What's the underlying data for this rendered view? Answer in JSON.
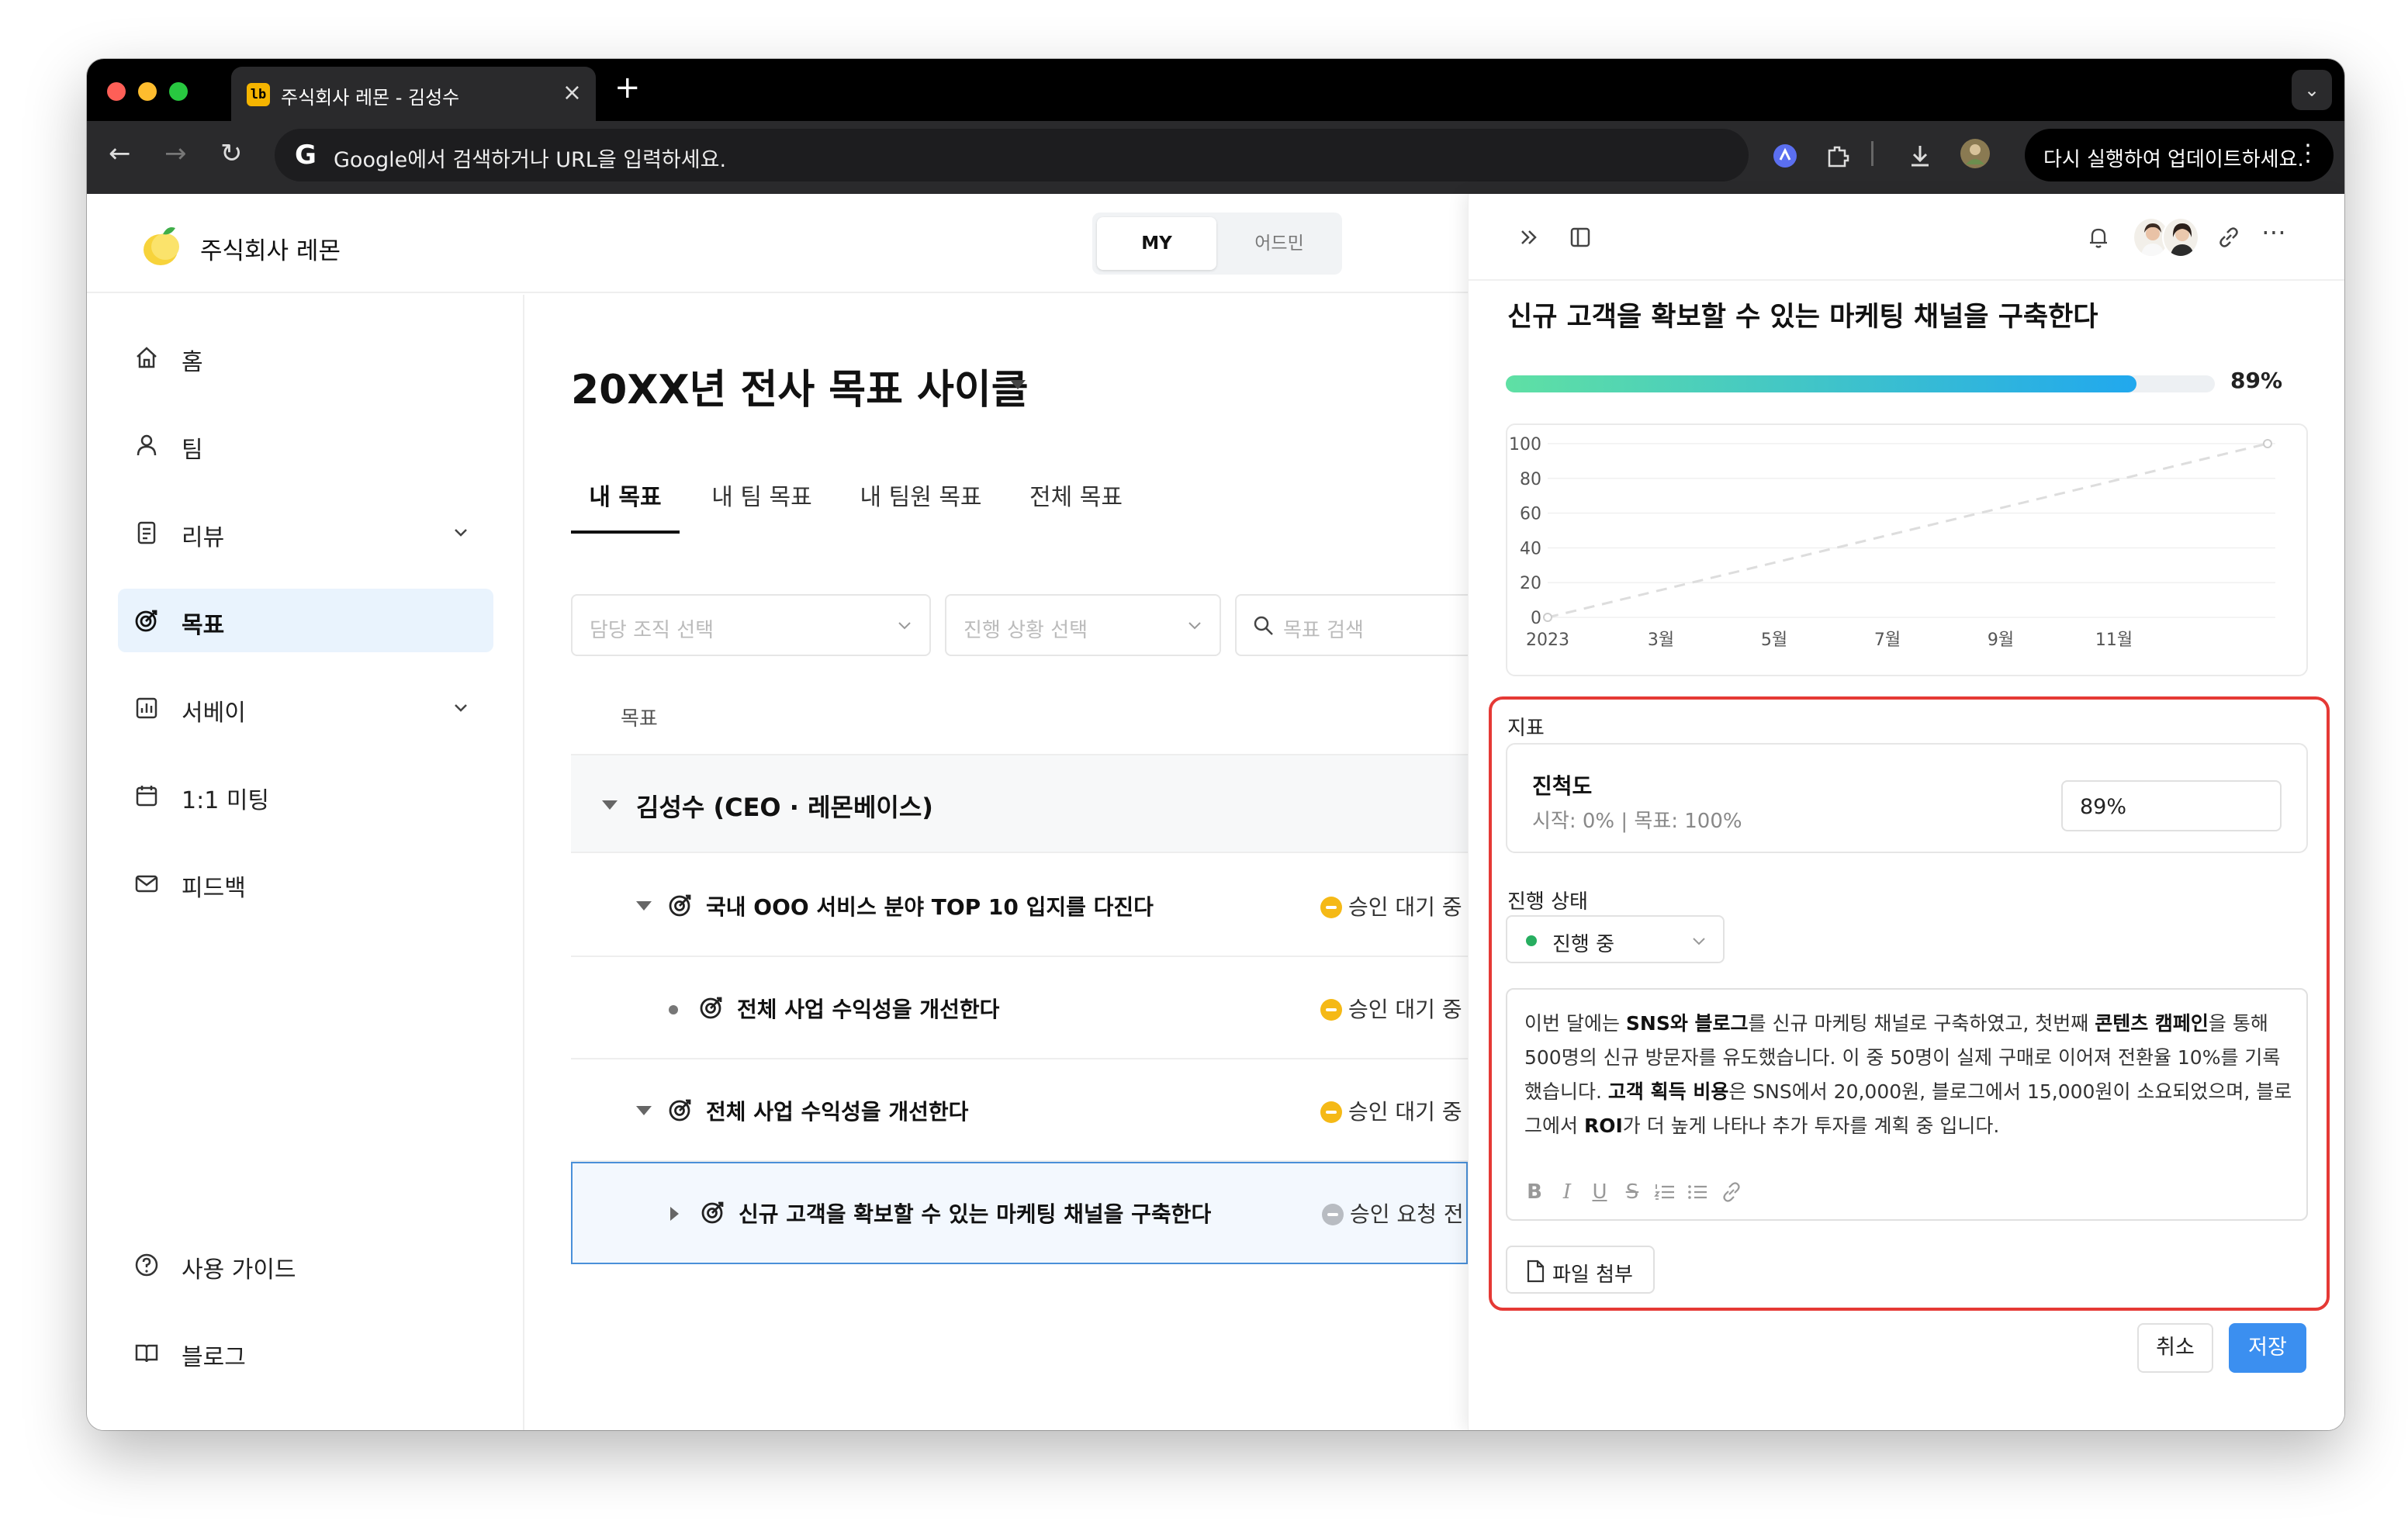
{
  "browser": {
    "tab_title": "주식회사 레몬 - 김성수",
    "favicon_text": "lb",
    "omnibox_placeholder": "Google에서 검색하거나 URL을 입력하세요.",
    "update_label": "다시 실행하여 업데이트하세요."
  },
  "header": {
    "company_name": "주식회사 레몬",
    "toggle": {
      "my": "MY",
      "admin": "어드민"
    }
  },
  "sidebar": {
    "items": [
      {
        "label": "홈",
        "icon": "home-icon"
      },
      {
        "label": "팀",
        "icon": "person-icon"
      },
      {
        "label": "리뷰",
        "icon": "document-icon",
        "expandable": true
      },
      {
        "label": "목표",
        "icon": "target-icon",
        "active": true
      },
      {
        "label": "서베이",
        "icon": "chart-icon",
        "expandable": true
      },
      {
        "label": "1:1 미팅",
        "icon": "calendar-icon"
      },
      {
        "label": "피드백",
        "icon": "mail-icon"
      }
    ],
    "bottom": [
      {
        "label": "사용 가이드",
        "icon": "help-icon"
      },
      {
        "label": "블로그",
        "icon": "book-icon"
      }
    ]
  },
  "main": {
    "title": "20XX년 전사 목표 사이클",
    "tabs": [
      "내 목표",
      "내 팀 목표",
      "내 팀원 목표",
      "전체 목표"
    ],
    "active_tab": 0,
    "filters": {
      "org_placeholder": "담당 조직 선택",
      "status_placeholder": "진행 상황 선택",
      "search_placeholder": "목표 검색"
    },
    "column_goal": "목표",
    "group_name": "김성수 (CEO · 레몬베이스)",
    "goals": [
      {
        "title": "국내 OOO 서비스 분야 TOP 10 입지를 다진다",
        "status": "승인 대기 중",
        "level": 0,
        "toggle": "expanded"
      },
      {
        "title": "전체 사업 수익성을 개선한다",
        "status": "승인 대기 중",
        "level": 1,
        "toggle": "bullet"
      },
      {
        "title": "전체 사업 수익성을 개선한다",
        "status": "승인 대기 중",
        "level": 0,
        "toggle": "expanded"
      },
      {
        "title": "신규 고객을 확보할 수 있는 마케팅 채널을 구축한다",
        "status": "승인 요청 전",
        "level": 1,
        "toggle": "collapsed",
        "selected": true
      }
    ],
    "status_colors": {
      "pending": "#f5b916",
      "draft": "#b8bcc2"
    }
  },
  "panel": {
    "title": "신규 고객을 확보할 수 있는 마케팅 채널을 구축한다",
    "progress_value": 89,
    "progress_label": "89%",
    "metric_section_label": "지표",
    "metric": {
      "name": "진척도",
      "range_text": "시작: 0% | 목표: 100%",
      "value": "89%"
    },
    "status_label": "진행 상태",
    "status_value": "진행 중",
    "editor": {
      "segments": [
        {
          "t": "이번 달에는 "
        },
        {
          "t": "SNS와 블로그",
          "b": true
        },
        {
          "t": "를 신규 마케팅 채널로 구축하였고, 첫번째 "
        },
        {
          "t": "콘텐츠 캠페인",
          "b": true
        },
        {
          "t": "을 통해 500명의 신규 방문자를 유도했습니다. 이 중 50명이 실제 구매로 이어져 전환율 10%를 기록했습니다. "
        },
        {
          "t": "고객 획득 비용",
          "b": true
        },
        {
          "t": "은 SNS에서 20,000원, 블로그에서 15,000원이 소요되었으며, 블로그에서 "
        },
        {
          "t": "ROI",
          "b": true
        },
        {
          "t": "가 더 높게 나타나 추가 투자를 계획 중 입니다."
        }
      ],
      "toolbar": [
        "B",
        "I",
        "U",
        "S"
      ]
    },
    "attach_label": "파일 첨부",
    "cancel_label": "취소",
    "save_label": "저장"
  },
  "chart_data": {
    "type": "line",
    "x": [
      "2023",
      "12월"
    ],
    "y": [
      0,
      100
    ],
    "xticks": [
      "2023",
      "3월",
      "5월",
      "7월",
      "9월",
      "11월"
    ],
    "yticks": [
      0,
      20,
      40,
      60,
      80,
      100
    ],
    "ylim": [
      0,
      100
    ],
    "line_style": "dashed",
    "line_color": "#dddddd"
  }
}
